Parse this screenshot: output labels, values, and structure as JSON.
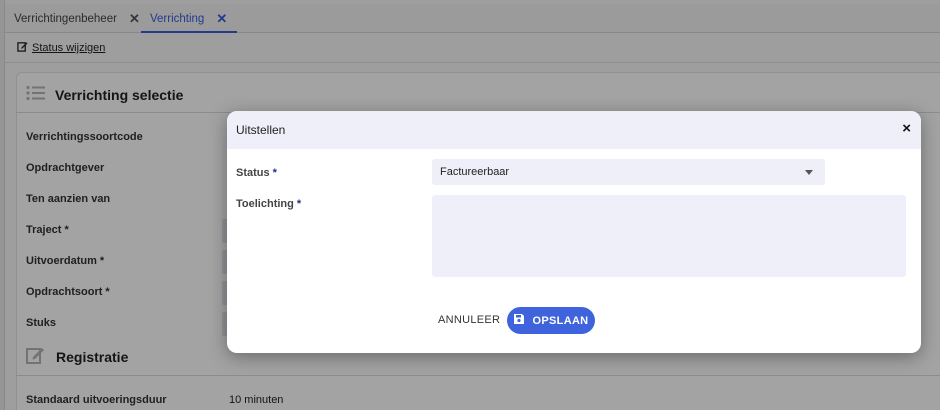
{
  "tabs": [
    {
      "label": "Verrichtingenbeheer",
      "close": "✕"
    },
    {
      "label": "Verrichting",
      "close": "✕"
    }
  ],
  "toolbar": {
    "status_link": "Status wijzigen"
  },
  "sections": {
    "selectie_title": "Verrichting selectie",
    "registratie_title": "Registratie"
  },
  "fields": {
    "verrichtingssoortcode": "Verrichtingssoortcode",
    "opdrachtgever": "Opdrachtgever",
    "ten_aanzien_van": "Ten aanzien van",
    "traject": "Traject",
    "uitvoerdatum": "Uitvoerdatum",
    "opdrachtsoort": "Opdrachtsoort",
    "stuks": "Stuks",
    "standaard_uitvoeringsduur": "Standaard uitvoeringsduur",
    "standaard_uitvoeringsduur_value": "10 minuten",
    "required_marker": "*"
  },
  "modal": {
    "title": "Uitstellen",
    "close": "×",
    "status_label": "Status",
    "status_value": "Factureerbaar",
    "toelichting_label": "Toelichting",
    "toelichting_value": "",
    "required_marker": "*",
    "cancel_label": "ANNULEER",
    "save_label": "OPSLAAN"
  },
  "colors": {
    "accent": "#3f63dc",
    "field_bg": "#efeff9",
    "header_bg": "#efeff9"
  }
}
